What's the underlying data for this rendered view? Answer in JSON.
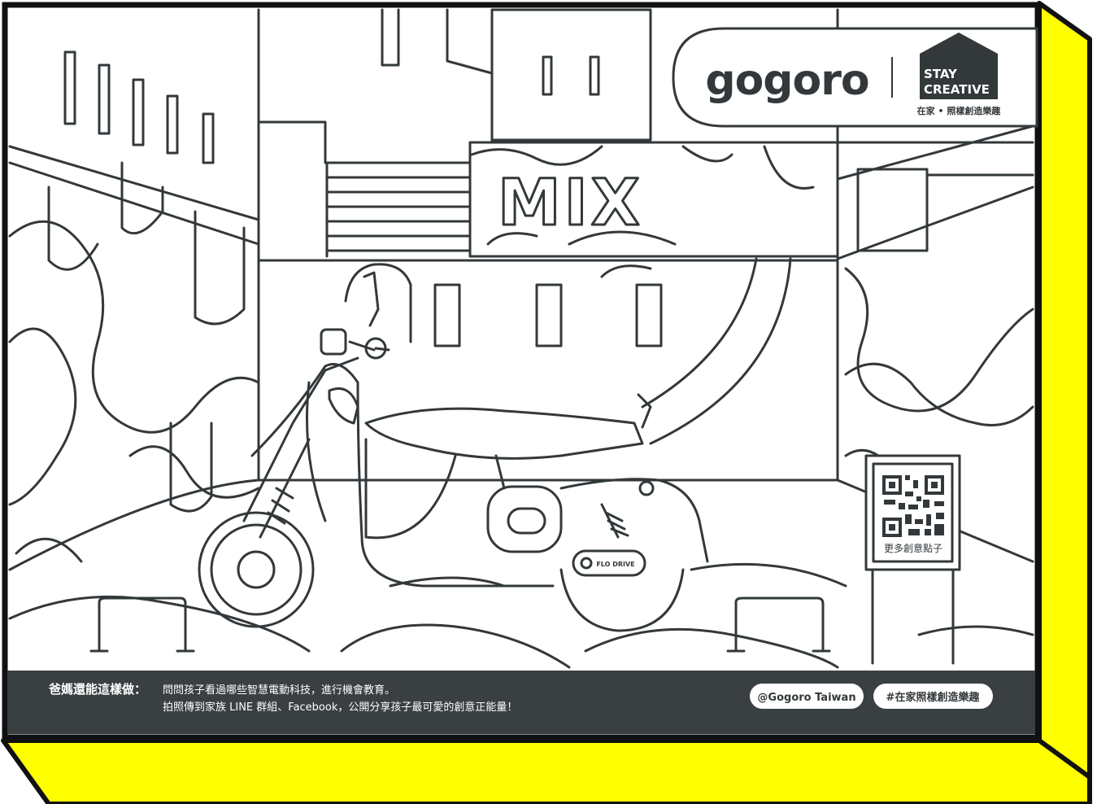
{
  "colors": {
    "accent_yellow": "#ffff00",
    "ink": "#33383b",
    "footer_bg": "#3a3f42",
    "paper": "#ffffff"
  },
  "brand": {
    "logo_text": "gogoro",
    "stay_creative_line1": "STAY",
    "stay_creative_line2": "CREATIVE",
    "tagline": "在家 • 照樣創造樂趣"
  },
  "scene": {
    "shop_sign": "MIX",
    "qr_label": "更多創意點子",
    "scooter_badge": "FLO DRIVE"
  },
  "footer": {
    "prompt_label": "爸媽還能這樣做：",
    "line1": "問問孩子看過哪些智慧電動科技，進行機會教育。",
    "line2": "拍照傳到家族 LINE 群組、Facebook，公開分享孩子最可愛的創意正能量！",
    "handle_pill": "@Gogoro Taiwan",
    "hashtag_pill": "#在家照樣創造樂趣"
  }
}
